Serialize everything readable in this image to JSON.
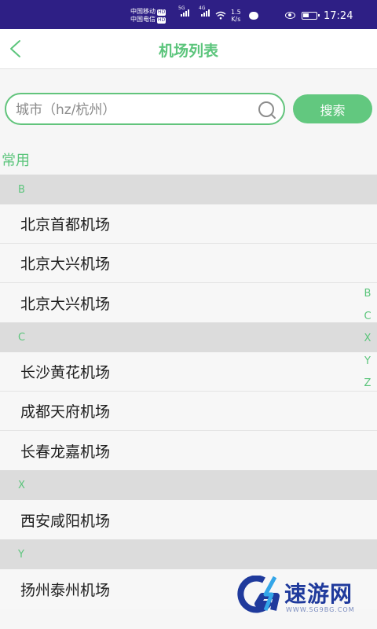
{
  "status_bar": {
    "carrier1": "中国移动",
    "carrier2": "中国电信",
    "hd": "HD",
    "net1": "5G",
    "net2": "4G",
    "speed_value": "1.5",
    "speed_unit": "K/s",
    "time": "17:24"
  },
  "header": {
    "title": "机场列表"
  },
  "search": {
    "placeholder": "城市（hz/杭州）",
    "value": "",
    "button_label": "搜索"
  },
  "common_label": "常用",
  "sections": [
    {
      "letter": "B",
      "airports": [
        "北京首都机场",
        "北京大兴机场",
        "北京大兴机场"
      ]
    },
    {
      "letter": "C",
      "airports": [
        "长沙黄花机场",
        "成都天府机场",
        "长春龙嘉机场"
      ]
    },
    {
      "letter": "X",
      "airports": [
        "西安咸阳机场"
      ]
    },
    {
      "letter": "Y",
      "airports": [
        "扬州泰州机场"
      ]
    }
  ],
  "index_letters": [
    "B",
    "C",
    "X",
    "Y",
    "Z"
  ],
  "watermark": {
    "text": "速游网",
    "url": "WWW.SG9BG.COM"
  },
  "colors": {
    "accent": "#5cc57c",
    "status_bar": "#2e1f85",
    "section_bg": "#dcdcdc"
  }
}
